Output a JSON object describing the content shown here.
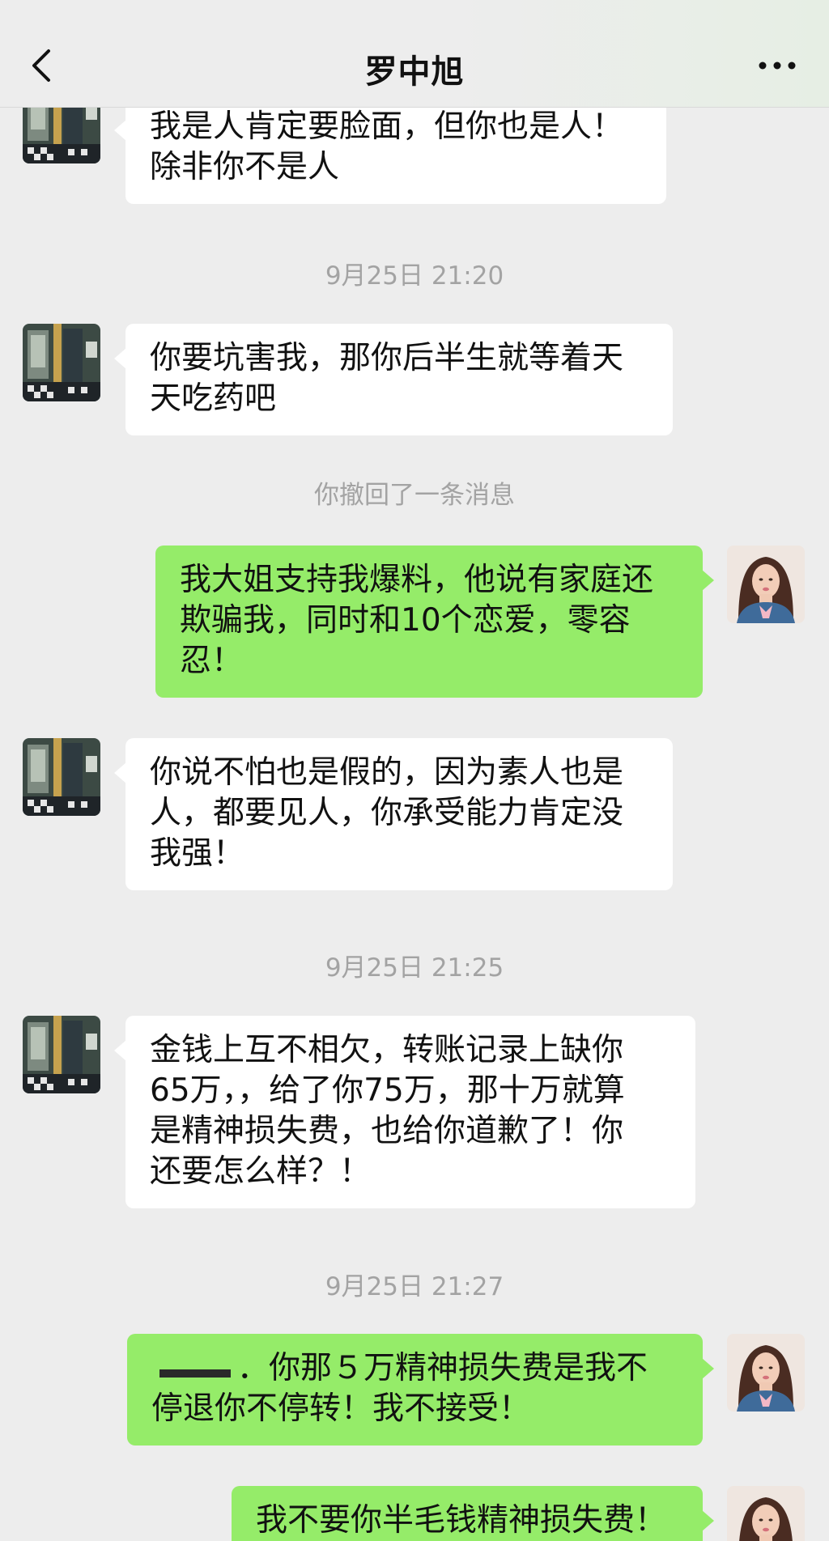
{
  "header": {
    "title": "罗中旭",
    "back_icon": "chevron-left-icon",
    "more_icon": "more-dots-icon"
  },
  "colors": {
    "background": "#ededed",
    "incoming_bubble": "#ffffff",
    "outgoing_bubble": "#95ec69",
    "meta_text": "#a3a3a3"
  },
  "messages": [
    {
      "type": "incoming",
      "text": "我是人肯定要脸面，但你也是人！\n除非你不是人"
    },
    {
      "type": "timestamp",
      "text": "9月25日 21:20"
    },
    {
      "type": "incoming",
      "text": "你要坑害我，那你后半生就等着天\n天吃药吧"
    },
    {
      "type": "system",
      "text": "你撤回了一条消息"
    },
    {
      "type": "outgoing",
      "text": "我大姐支持我爆料，他说有家庭还\n欺骗我，同时和10个恋爱，零容\n忍！"
    },
    {
      "type": "incoming",
      "text": "你说不怕也是假的，因为素人也是\n人，都要见人，你承受能力肯定没\n我强！"
    },
    {
      "type": "timestamp",
      "text": "9月25日 21:25"
    },
    {
      "type": "incoming",
      "text": "金钱上互不相欠，转账记录上缺你\n65万，，给了你75万，那十万就算\n是精神损失费，也给你道歉了！你\n还要怎么样？！"
    },
    {
      "type": "timestamp",
      "text": "9月25日 21:27"
    },
    {
      "type": "outgoing",
      "text_after_redaction": "．你那５万精神损失费是我不\n停退你不停转！我不接受！"
    },
    {
      "type": "outgoing",
      "text": "我不要你半毛钱精神损失费！"
    }
  ]
}
